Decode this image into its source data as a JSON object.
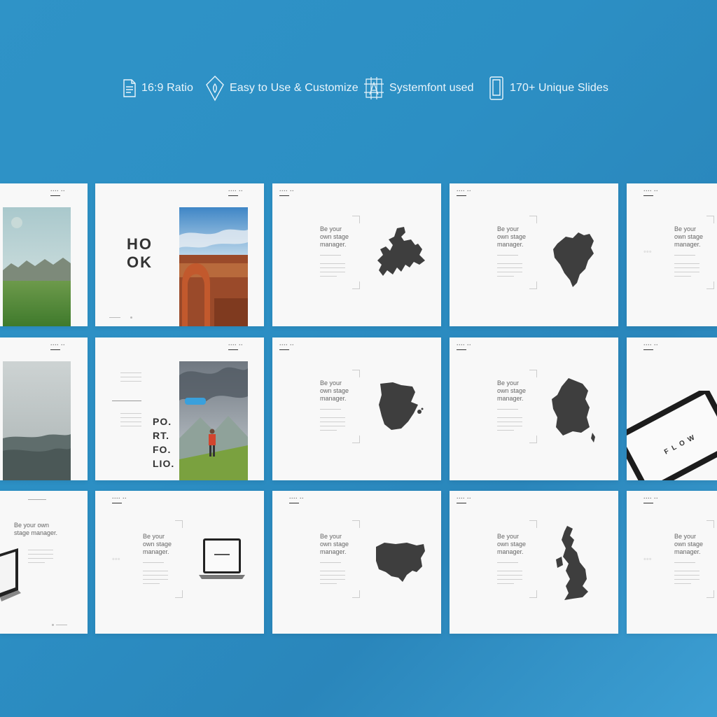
{
  "features": [
    {
      "icon": "document-icon",
      "label": "16:9 Ratio"
    },
    {
      "icon": "house-icon",
      "label": "Easy to Use & Customize"
    },
    {
      "icon": "font-icon",
      "label": "Systemfont used"
    },
    {
      "icon": "phone-icon",
      "label": "170+ Unique Slides"
    }
  ],
  "slide_text": {
    "hook": [
      "HO",
      "OK"
    ],
    "portfolio": [
      "PO.",
      "RT.",
      "FO.",
      "LIO."
    ],
    "stage_manager_3": [
      "Be your",
      "own stage",
      "manager."
    ],
    "stage_manager_2": [
      "Be your own",
      "stage manager."
    ],
    "flow": "FLOW"
  },
  "maps": [
    "europe-map-icon",
    "north-america-map-icon",
    "spain-map-icon",
    "france-map-icon",
    "usa-map-icon",
    "uk-map-icon"
  ]
}
